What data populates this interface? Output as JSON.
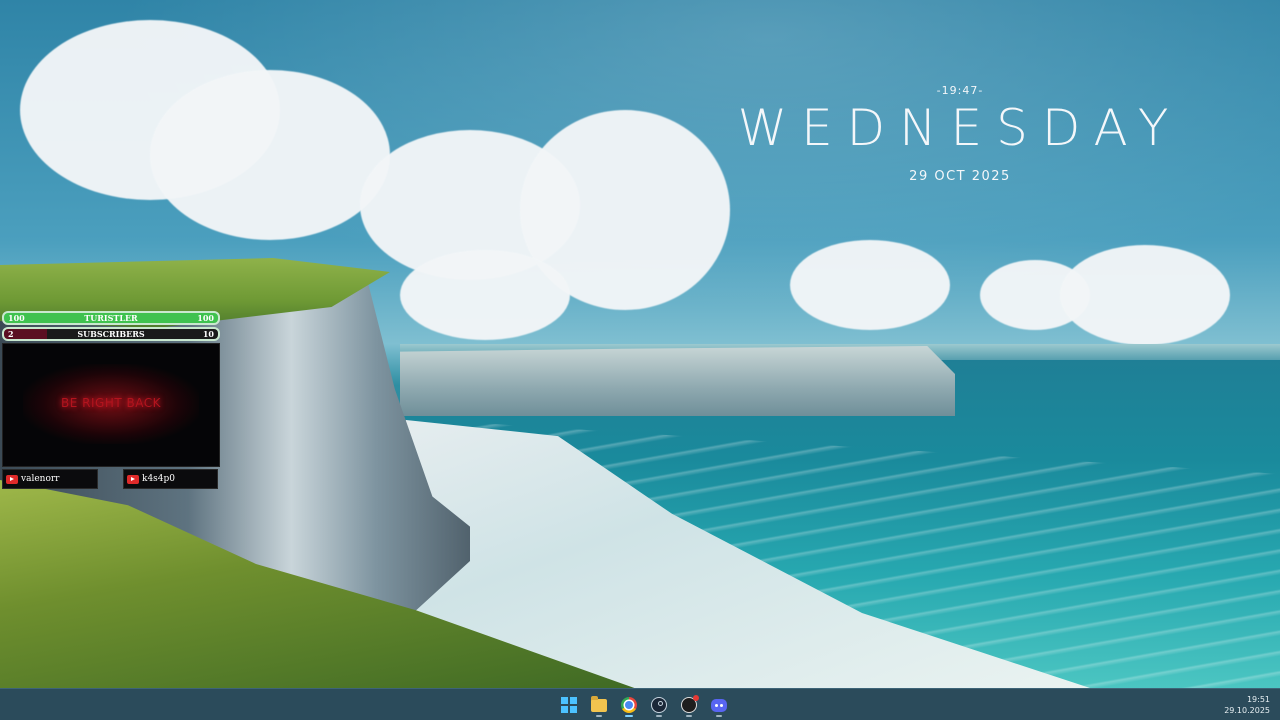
{
  "desktop": {
    "clock_widget": {
      "time": "-19:47-",
      "day": "WEDNESDAY",
      "date": "29 OCT 2025"
    }
  },
  "stream_overlay": {
    "follower_goal": {
      "left_value": "100",
      "label": "TURISTLER",
      "right_value": "100"
    },
    "subscriber_goal": {
      "left_value": "2",
      "label": "SUBSCRIBERS",
      "right_value": "10"
    },
    "brb_screen": {
      "text": "BE RIGHT BACK"
    },
    "users": [
      {
        "name": "valenorr",
        "platform_icon": "youtube-icon"
      },
      {
        "name": "k4s4p0",
        "platform_icon": "youtube-icon"
      }
    ]
  },
  "taskbar": {
    "apps": [
      {
        "name": "start",
        "icon": "windows-start-icon",
        "active": false
      },
      {
        "name": "file-explorer",
        "icon": "folder-icon",
        "active": false
      },
      {
        "name": "chrome",
        "icon": "chrome-icon",
        "active": true
      },
      {
        "name": "steam",
        "icon": "steam-icon",
        "active": false
      },
      {
        "name": "obs",
        "icon": "obs-icon",
        "active": false
      },
      {
        "name": "discord",
        "icon": "discord-icon",
        "active": false
      }
    ],
    "clock": {
      "time": "19:51",
      "date": "29.10.2025"
    }
  },
  "colors": {
    "accent_taskbar": "#2b4b5b",
    "goal_bar_green": "#3fc24f",
    "brb_red": "#b3141e"
  }
}
